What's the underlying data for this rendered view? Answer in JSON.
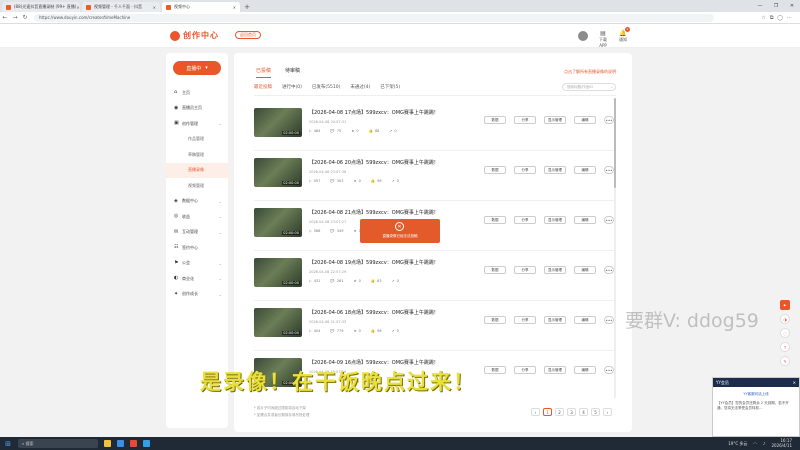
{
  "browser": {
    "tabs": [
      {
        "label": "(88)光速抖音直播录制 (99+ 直播)"
      },
      {
        "label": "视频管理 - 千人千面 - 抖音"
      },
      {
        "label": "视频中心"
      }
    ],
    "url": "https://www.douyin.com/creator/timeMachine",
    "window_controls": [
      "—",
      "❐",
      "✕"
    ]
  },
  "site": {
    "logo_text": "创作中心",
    "back_button": "返回首页",
    "header_items": [
      {
        "icon": "▤",
        "label": "下载APP"
      },
      {
        "icon": "🔔",
        "label": "通知"
      }
    ],
    "notif_count": "1"
  },
  "sidebar": {
    "live_button": "直播中",
    "items": [
      {
        "icon": "⌂",
        "label": "主页",
        "sub": false,
        "chev": false
      },
      {
        "icon": "◉",
        "label": "直播员主页",
        "sub": false,
        "chev": false
      },
      {
        "icon": "▣",
        "label": "创作管理",
        "sub": false,
        "chev": true
      },
      {
        "label": "作品管理",
        "sub": true
      },
      {
        "label": "草稿管理",
        "sub": true
      },
      {
        "label": "直播录像",
        "sub": true,
        "active": true
      },
      {
        "label": "视频管理",
        "sub": true
      },
      {
        "icon": "◈",
        "label": "数据中心",
        "sub": false,
        "chev": true
      },
      {
        "icon": "◎",
        "label": "收益",
        "sub": false,
        "chev": true
      },
      {
        "icon": "✉",
        "label": "互动管理",
        "sub": false,
        "chev": true
      },
      {
        "icon": "☷",
        "label": "签约中心",
        "sub": false,
        "chev": false
      },
      {
        "icon": "⚑",
        "label": "公会",
        "sub": false,
        "chev": true
      },
      {
        "icon": "◐",
        "label": "商业化",
        "sub": false,
        "chev": true
      },
      {
        "icon": "✦",
        "label": "创作成长",
        "sub": false,
        "chev": true
      }
    ]
  },
  "main": {
    "tabs": [
      "已投稿",
      "待审稿"
    ],
    "top_note": "点击了解所有直播录像的说明",
    "filters": [
      "最近投稿",
      "进行中(0)",
      "已发布(5510)",
      "未通过(4)",
      "已下架(5)"
    ],
    "search_placeholder": "搜索标题/作品ID",
    "rows": [
      {
        "title": "【2026-04-08 17点场】599zxcv：OMG赛事上午跳跳!",
        "date": "2026-04-08 20:07:31",
        "duration": "02:00:00",
        "stats": [
          "484",
          "75",
          "0",
          "88",
          "0"
        ]
      },
      {
        "title": "【2026-04-06 20点场】599zxcv：OMG赛事上午跳跳!",
        "date": "2026-04-06 23:07:36",
        "duration": "02:00:00",
        "stats": [
          "557",
          "303",
          "0",
          "98",
          "0"
        ]
      },
      {
        "title": "【2026-04-08 21点场】599zxcv：OMG赛事上午跳跳!",
        "date": "2026-04-08 23:07:27",
        "duration": "02:00:00",
        "stats": [
          "566",
          "349",
          "0",
          "70",
          "0"
        ]
      },
      {
        "title": "【2026-04-08 19点场】599zxcv：OMG赛事上午跳跳!",
        "date": "2026-04-08 22:07:29",
        "duration": "02:00:00",
        "stats": [
          "431",
          "261",
          "0",
          "83",
          "0"
        ]
      },
      {
        "title": "【2026-04-06 18点场】599zxcv：OMG赛事上午跳跳!",
        "date": "2026-04-06 21:07:33",
        "duration": "02:00:00",
        "stats": [
          "404",
          "779",
          "0",
          "96",
          "0"
        ]
      },
      {
        "title": "【2026-04-09 16点场】599zxcv：OMG赛事上午跳跳!",
        "date": "2026-04-09 19:07:26",
        "duration": "02:00:00",
        "stats": [
          "",
          "",
          "",
          "",
          ""
        ]
      }
    ],
    "actions": [
      "数据",
      "分享",
      "显示管理",
      "编辑"
    ],
    "more": "•••",
    "footnotes": [
      "* 若片子时间超过限制将自动下架",
      "* 如需合并或者长期保存请尽快处理"
    ],
    "pages": [
      "‹",
      "1",
      "2",
      "3",
      "4",
      "5",
      "›"
    ]
  },
  "toast": {
    "icon": "✕",
    "text": "直播录像已经无法投稿"
  },
  "overlay": {
    "watermark": "要群V: ddog59",
    "subtitle": "是录像！在干饭晚点过来！"
  },
  "notice": {
    "header": "YY会员",
    "title": "YY客服问话上线",
    "body": "【YY会员】您的会员还剩余 2 天到期，若不开通，您将无法享受会员特权…"
  },
  "taskbar": {
    "search": "搜索",
    "weather": "19°C 多云",
    "time": "16:17",
    "date": "2026/4/11"
  }
}
